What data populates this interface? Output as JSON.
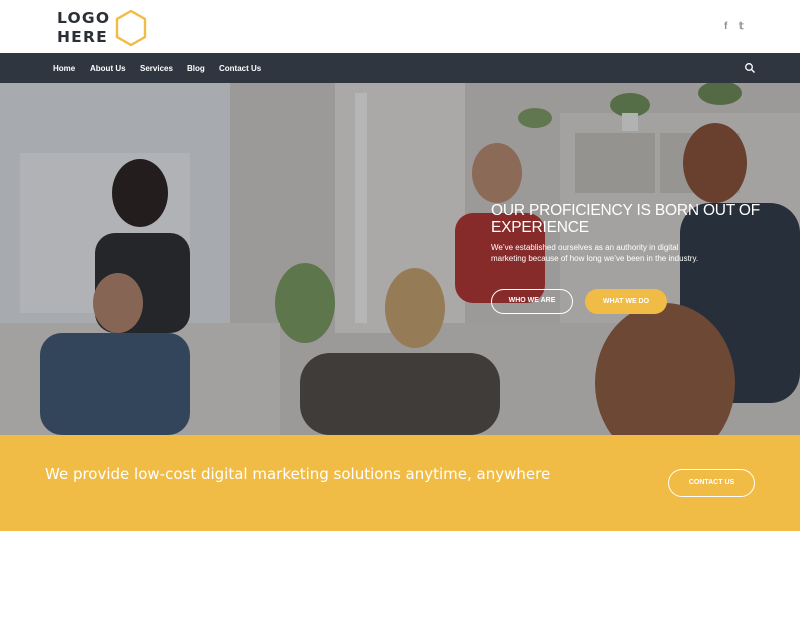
{
  "header": {
    "logo_line1": "LOGO",
    "logo_line2": "HERE",
    "social": {
      "facebook": "f",
      "twitter": "𝕥"
    }
  },
  "nav": {
    "items": [
      "Home",
      "About Us",
      "Services",
      "Blog",
      "Contact Us"
    ],
    "search_icon": "search-icon"
  },
  "hero": {
    "title": "OUR PROFICIENCY IS BORN OUT OF EXPERIENCE",
    "subtitle": "We’ve established ourselves as an authority in digital marketing because of how long we’ve been in the industry.",
    "buttons": {
      "who_we_are": "WHO WE ARE",
      "what_we_do": "WHAT WE DO"
    }
  },
  "band": {
    "text": "We provide low-cost digital marketing solutions anytime, anywhere",
    "button": "CONTACT US"
  },
  "colors": {
    "accent": "#f1bc45",
    "nav_bg": "#2f3640",
    "text_dark": "#2b2f36"
  }
}
